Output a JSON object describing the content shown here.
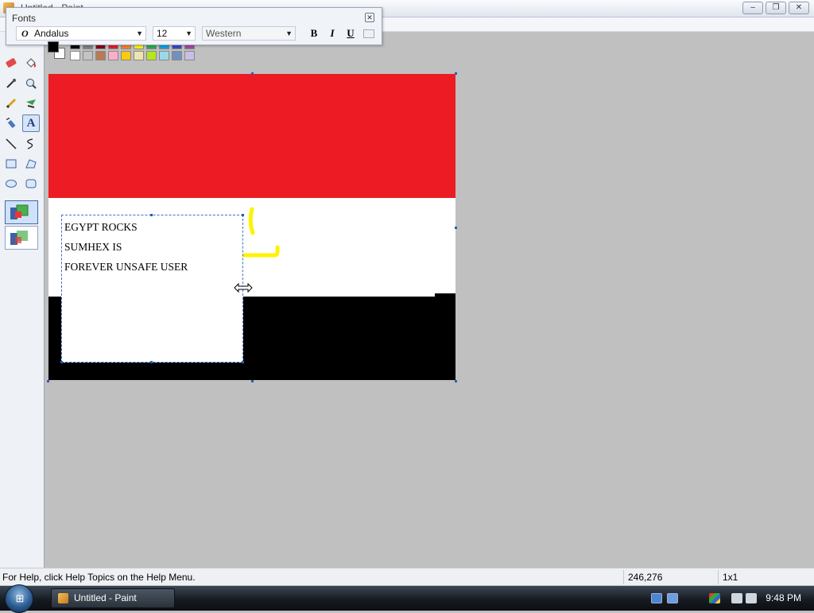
{
  "window": {
    "title": "Untitled - Paint",
    "controls": {
      "minimize": "–",
      "maximize": "❐",
      "close": "✕"
    }
  },
  "fonts_toolbar": {
    "title": "Fonts",
    "font_name": "Andalus",
    "font_size": "12",
    "script": "Western",
    "bold_label": "B",
    "italic_label": "I",
    "underline_label": "U"
  },
  "palette": {
    "foreground": "#000000",
    "background": "#ffffff",
    "row1": [
      "#000000",
      "#7f7f7f",
      "#880015",
      "#ed1c24",
      "#ff7f27",
      "#fff200",
      "#22b14c",
      "#00a2e8",
      "#3f48cc",
      "#a349a4"
    ],
    "row2": [
      "#ffffff",
      "#c3c3c3",
      "#b97a57",
      "#ffaec9",
      "#ffc90e",
      "#efe4b0",
      "#b5e61d",
      "#99d9ea",
      "#7092be",
      "#c8bfe7"
    ]
  },
  "canvas": {
    "bands": [
      {
        "name": "red-band",
        "color": "#ed1c24"
      },
      {
        "name": "white-band",
        "color": "#ffffff"
      },
      {
        "name": "black-band",
        "color": "#000000"
      }
    ],
    "yellow_stroke_color": "#fff200"
  },
  "text_box": {
    "lines": [
      "EGYPT ROCKS",
      "SUMHEX IS",
      "FOREVER UNSAFE USER"
    ]
  },
  "statusbar": {
    "help_text": "For Help, click Help Topics on the Help Menu.",
    "coordinates": "246,276",
    "size": "1x1"
  },
  "taskbar": {
    "task_label": "Untitled - Paint",
    "clock": "9:48 PM"
  }
}
